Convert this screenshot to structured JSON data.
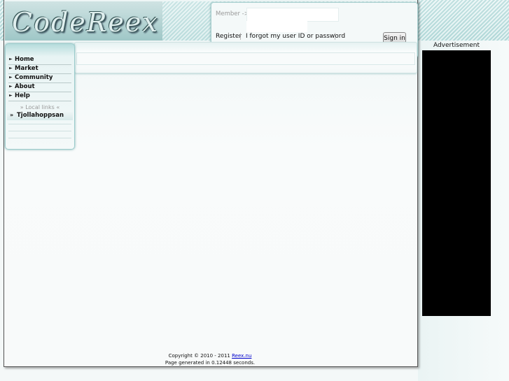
{
  "header": {
    "logo_text": "CodeReex"
  },
  "login": {
    "member_label": "Member ->",
    "register_label": "Register",
    "forgot_label": "I forgot my user ID or password",
    "signin_label": "Sign in"
  },
  "menu": {
    "items": [
      {
        "label": "Home"
      },
      {
        "label": "Market"
      },
      {
        "label": "Community"
      },
      {
        "label": "About"
      },
      {
        "label": "Help"
      }
    ],
    "local_heading": "» Local links «",
    "local_items": [
      {
        "label": "Tjollahoppsan"
      }
    ],
    "arrow_glyph": "►",
    "local_arrow_glyph": "»"
  },
  "sidebar": {
    "ad_title": "Advertisement"
  },
  "footer": {
    "copyright_prefix": "Copyright © 2010 - 2011",
    "copyright_link": "Reex.nu",
    "generated": "Page generated in 0.12448 seconds."
  },
  "colors": {
    "accent": "#9ccccc",
    "ad_background": "#000000",
    "link": "#0000cc"
  }
}
